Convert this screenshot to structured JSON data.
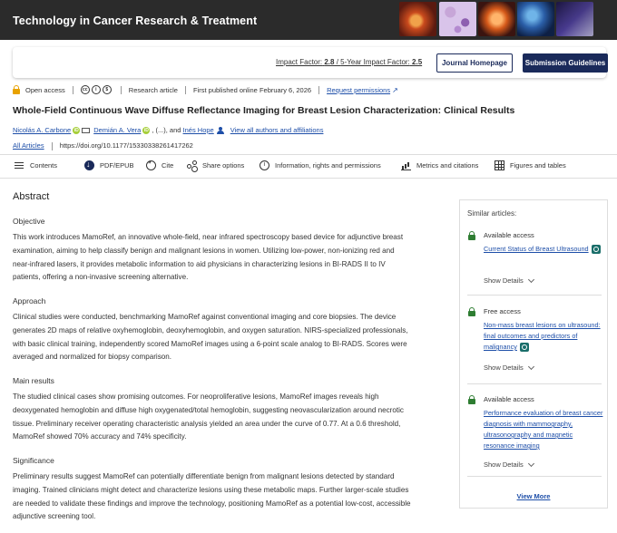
{
  "journal": {
    "title": "Technology in Cancer Research & Treatment",
    "impact_factor_label": "Impact Factor:",
    "impact_factor": "2.8",
    "five_year_label": "5-Year Impact Factor:",
    "five_year": "2.5",
    "homepage_button": "Journal Homepage",
    "submission_button": "Submission Guidelines"
  },
  "meta": {
    "access": "Open access",
    "article_type": "Research article",
    "published": "First published online February 6, 2026",
    "request_permissions": "Request permissions"
  },
  "article": {
    "title": "Whole-Field Continuous Wave Diffuse Reflectance Imaging for Breast Lesion Characterization: Clinical Results",
    "authors": [
      "Nicolás A. Carbone",
      "Demián A. Vera",
      "Inés Hope"
    ],
    "ellipsis": "(...)",
    "and": "and",
    "all_authors_link": "View all authors and affiliations",
    "all_articles": "All Articles",
    "doi": "https://doi.org/10.1177/15330338261417262"
  },
  "toolbar": {
    "contents": "Contents",
    "pdf": "PDF/EPUB",
    "cite": "Cite",
    "share": "Share options",
    "info": "Information, rights and permissions",
    "metrics": "Metrics and citations",
    "figures": "Figures and tables"
  },
  "abstract": {
    "heading": "Abstract",
    "sections": [
      {
        "title": "Objective",
        "text": "This work introduces MamoRef, an innovative whole-field, near infrared spectroscopy based device for adjunctive breast examination, aiming to help classify benign and malignant lesions in women. Utilizing low-power, non-ionizing red and near-infrared lasers, it provides metabolic information to aid physicians in characterizing lesions in BI-RADS II to IV patients, offering a non-invasive screening alternative."
      },
      {
        "title": "Approach",
        "text": "Clinical studies were conducted, benchmarking MamoRef against conventional imaging and core biopsies. The device generates 2D maps of relative oxyhemoglobin, deoxyhemoglobin, and oxygen saturation. NIRS-specialized professionals, with basic clinical training, independently scored MamoRef images using a 6-point scale analog to BI-RADS. Scores were averaged and normalized for biopsy comparison."
      },
      {
        "title": "Main results",
        "text": "The studied clinical cases show promising outcomes. For neoproliferative lesions, MamoRef images reveals high deoxygenated hemoglobin and diffuse high oxygenated/total hemoglobin, suggesting neovascularization around necrotic tissue. Preliminary receiver operating characteristic analysis yielded an area under the curve of 0.77. At a 0.6 threshold, MamoRef showed 70% accuracy and 74% specificity."
      },
      {
        "title": "Significance",
        "text": "Preliminary results suggest MamoRef can potentially differentiate benign from malignant lesions detected by standard imaging. Trained clinicians might detect and characterize lesions using these metabolic maps. Further larger-scale studies are needed to validate these findings and improve the technology, positioning MamoRef as a potential low-cost, accessible adjunctive screening tool."
      }
    ]
  },
  "sidebar": {
    "heading": "Similar articles:",
    "items": [
      {
        "access": "Available access",
        "title": "Current Status of Breast Ultrasound",
        "details": "Show Details"
      },
      {
        "access": "Free access",
        "title": "Non-mass breast lesions on ultrasound: final outcomes and predictors of malignancy",
        "details": "Show Details"
      },
      {
        "access": "Available access",
        "title": "Performance evaluation of breast cancer diagnosis with mammography, ultrasonography and magnetic resonance imaging",
        "details": "Show Details"
      }
    ],
    "view_more": "View More"
  },
  "colors": {
    "banner": "#2b2b2b",
    "navy": "#1a2a5a",
    "link": "#1d4ea8",
    "open_access": "#e8a200",
    "available_access": "#2e7d32"
  }
}
